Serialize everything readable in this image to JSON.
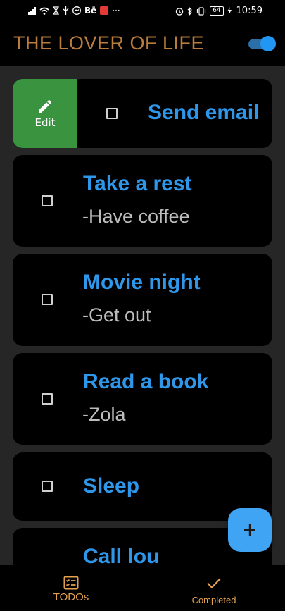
{
  "status_bar": {
    "time": "10:59",
    "battery": "64",
    "be_label": "Bē",
    "more": "···"
  },
  "app_bar": {
    "title": "THE LOVER OF LIFE",
    "toggle_on": true
  },
  "swipe_action": {
    "label": "Edit",
    "color": "#3a933f"
  },
  "todos": [
    {
      "title": "Send email",
      "subtitle": ""
    },
    {
      "title": "Take a rest",
      "subtitle": "-Have coffee"
    },
    {
      "title": "Movie night",
      "subtitle": "-Get out"
    },
    {
      "title": "Read a book",
      "subtitle": "-Zola"
    },
    {
      "title": "Sleep",
      "subtitle": ""
    },
    {
      "title": "Call lou",
      "subtitle": ""
    }
  ],
  "fab": {
    "icon": "plus-icon"
  },
  "bottom_nav": {
    "items": [
      {
        "label": "TODOs",
        "icon": "checklist-icon",
        "selected": true
      },
      {
        "label": "Completed",
        "icon": "check-icon",
        "selected": false
      }
    ]
  },
  "colors": {
    "accent": "#2f97ea",
    "title": "#b97c3c",
    "nav_label": "#e3a04f",
    "background": "#262626"
  }
}
